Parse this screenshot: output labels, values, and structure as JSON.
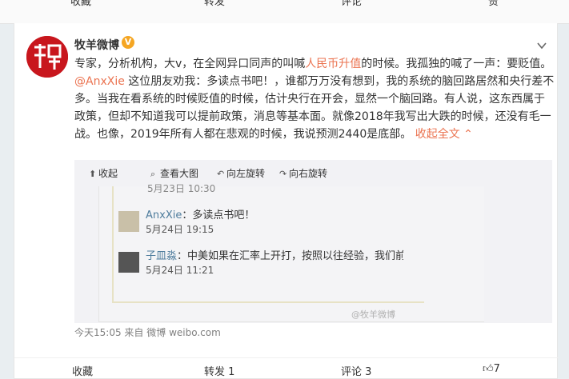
{
  "topbar": {
    "left_label": "收藏",
    "mid1_label": "转发",
    "mid2_label": "评论",
    "right_label": "赞"
  },
  "post": {
    "username": "牧羊微博",
    "verified_badge": "V",
    "content": {
      "p1": "专家，分析机构，大v，在全网异口同声的叫喊",
      "topic": "人民币升值",
      "p2": "的时候。我孤独的喊了一声：要贬值。",
      "mention": "@AnxXie",
      "p3": " 这位朋友劝我：多读点书吧！，谁都万万没有想到，我的系统的脑回路居然和央行差不多。当我在看系统的时候贬值的时候，估计央行在开会，显然一个脑回路。有人说，这东西属于政策，但却不知道我可以提前政策，消息等基本面。就像2018年我写出大跌的时候，还没有毛一战。也像，2019年所有人都在悲观的时候，我说预测2440是底部。",
      "collapse": "收起全文"
    },
    "media": {
      "toolbar": {
        "collapse": "收起",
        "view_large": "查看大图",
        "rotate_left": "向左旋转",
        "rotate_right": "向右旋转"
      },
      "old_time": "5月23日 10:30",
      "comments": [
        {
          "name": "AnxXie",
          "text": "：多读点书吧！",
          "time": "5月24日 19:15"
        },
        {
          "name": "子皿淼",
          "text": "：中美如果在汇率上开打，按照以往经验，我们前期",
          "time": "5月24日 11:21"
        }
      ],
      "watermark": "@牧羊微博"
    },
    "meta": {
      "time": "今天15:05",
      "source_prefix": "来自",
      "source": "微博 weibo.com"
    },
    "footer": {
      "favorite": "收藏",
      "repost": "转发 1",
      "comment": "评论 3",
      "like_count": "7"
    }
  }
}
